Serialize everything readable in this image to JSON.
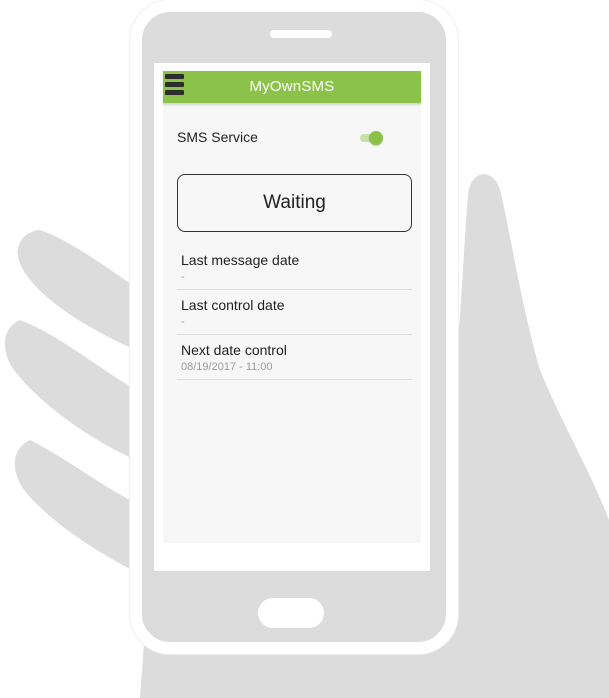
{
  "app": {
    "title": "MyOwnSMS",
    "accent_color": "#8bc34a"
  },
  "service": {
    "label": "SMS Service",
    "enabled": true
  },
  "status": {
    "text": "Waiting"
  },
  "info": [
    {
      "title": "Last message date",
      "value": "-"
    },
    {
      "title": "Last control date",
      "value": "-"
    },
    {
      "title": "Next date control",
      "value": "08/19/2017 - 11:00"
    }
  ],
  "icons": {
    "menu": "hamburger-menu-icon"
  }
}
